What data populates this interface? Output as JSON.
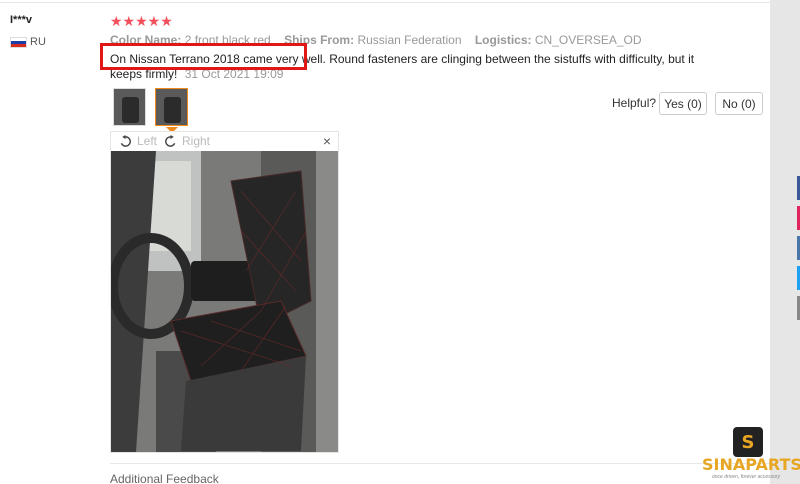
{
  "review": {
    "user_name": "I***v",
    "country_code": "RU",
    "rating": 5,
    "stars": "★★★★★",
    "color_label": "Color Name:",
    "color_value": "2 front black red",
    "ships_label": "Ships From:",
    "ships_value": "Russian Federation",
    "logistics_label": "Logistics:",
    "logistics_value": "CN_OVERSEA_OD",
    "text": "On Nissan Terrano 2018 came very well. Round fasteners are clinging between the sistuffs with difficulty, but it keeps firmly!",
    "date": "31 Oct 2021 19:09",
    "helpful_label": "Helpful?",
    "yes_label": "Yes (0)",
    "no_label": "No (0)"
  },
  "viewer": {
    "rotate_left_label": "Left",
    "rotate_right_label": "Right",
    "close_label": "×"
  },
  "footer": {
    "additional_feedback": "Additional Feedback"
  },
  "watermark": {
    "brand": "SINAPARTS",
    "tagline": "once driven, forever accessory",
    "logo_letter": "S"
  },
  "colors": {
    "star": "#f2505b",
    "highlight": "#e01717",
    "selected_thumb": "#f08a1c",
    "brand": "#e7a623"
  }
}
